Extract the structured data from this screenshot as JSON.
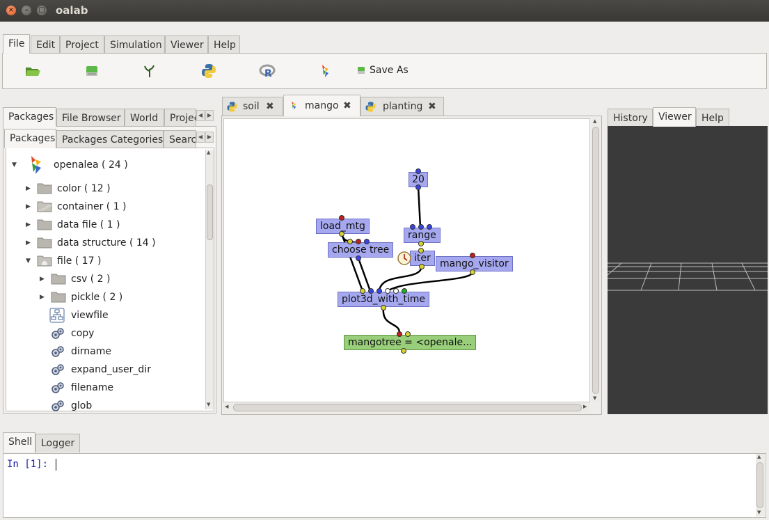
{
  "window": {
    "title": "oalab"
  },
  "ribbon": {
    "tabs": [
      "File",
      "Edit",
      "Project",
      "Simulation",
      "Viewer",
      "Help"
    ],
    "save_as_label": "Save As"
  },
  "left_panel": {
    "tabs": [
      "Packages",
      "File Browser",
      "World",
      "Projec"
    ],
    "subtabs": [
      "Packages",
      "Packages Categories",
      "Searc"
    ],
    "tree": [
      {
        "label": "openalea ( 24 )"
      },
      {
        "label": "color ( 12 )"
      },
      {
        "label": "container ( 1 )"
      },
      {
        "label": "data file ( 1 )"
      },
      {
        "label": "data structure ( 14 )"
      },
      {
        "label": "file ( 17 )"
      },
      {
        "label": "csv ( 2 )"
      },
      {
        "label": "pickle ( 2 )"
      },
      {
        "label": "viewfile"
      },
      {
        "label": "copy"
      },
      {
        "label": "dirname"
      },
      {
        "label": "expand_user_dir"
      },
      {
        "label": "filename"
      },
      {
        "label": "glob"
      }
    ]
  },
  "editor": {
    "tabs": [
      {
        "label": "soil",
        "close": "✖"
      },
      {
        "label": "mango",
        "close": "✖"
      },
      {
        "label": "planting",
        "close": "✖"
      }
    ],
    "nodes": {
      "n20": "20",
      "range": "range",
      "load_mtg": "load_mtg",
      "choose_tree": "choose tree",
      "iter": "iter",
      "mango_visitor": "mango_visitor",
      "plot3d": "plot3d_with_time",
      "mangotree": "mangotree = <openale..."
    }
  },
  "right_panel": {
    "tabs": [
      "History",
      "Viewer",
      "Help"
    ]
  },
  "bottom": {
    "tabs": [
      "Shell",
      "Logger"
    ],
    "prompt": "In [1]:"
  }
}
